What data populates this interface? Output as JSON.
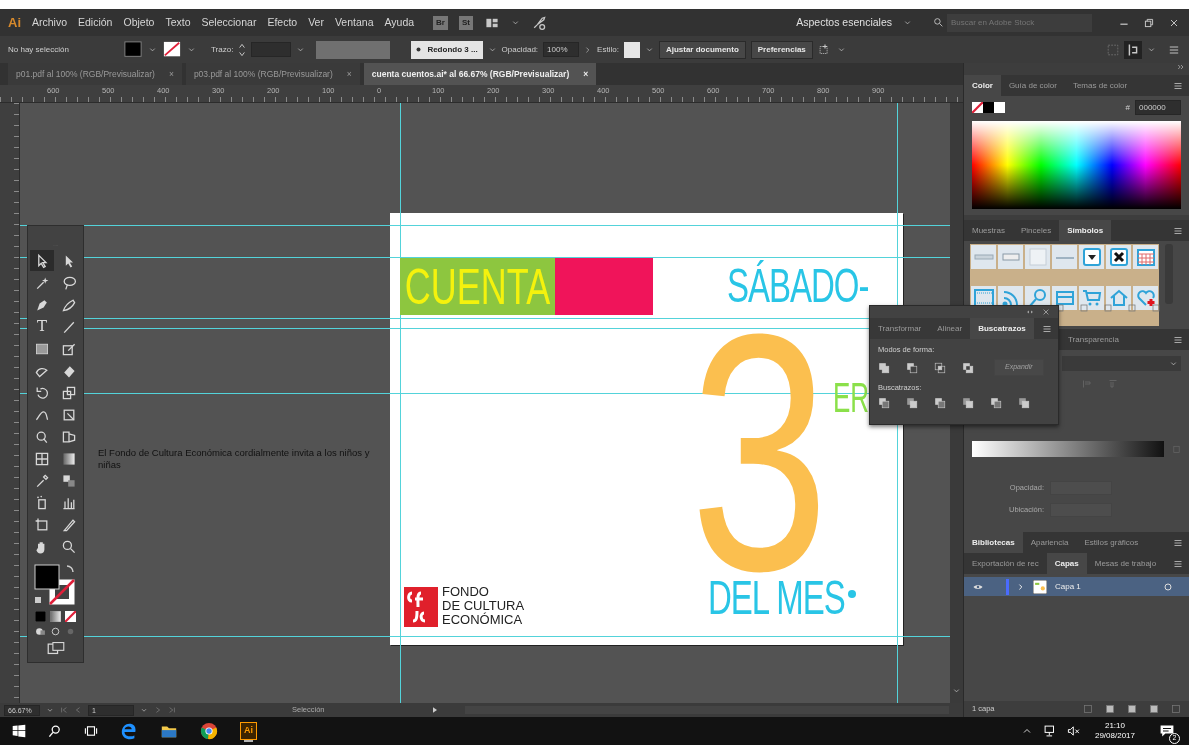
{
  "menu_bar": {
    "logo": "Ai",
    "items": [
      "Archivo",
      "Edición",
      "Objeto",
      "Texto",
      "Seleccionar",
      "Efecto",
      "Ver",
      "Ventana",
      "Ayuda"
    ],
    "bridge": "Br",
    "stock": "St",
    "workspace": "Aspectos esenciales",
    "search": {
      "placeholder": "Buscar en Adobe Stock"
    }
  },
  "control_bar": {
    "selection": "No hay selección",
    "stroke_label": "Trazo:",
    "brush": "Redondo 3 ...",
    "opacity_label": "Opacidad:",
    "opacity": "100%",
    "style_label": "Estilo:",
    "buttons": [
      "Ajustar documento",
      "Preferencias"
    ]
  },
  "document_tabs": [
    {
      "label": "p01.pdf al 100% (RGB/Previsualizar)",
      "close": "×",
      "selected": false
    },
    {
      "label": "p03.pdf al 100% (RGB/Previsualizar)",
      "close": "×",
      "selected": false
    },
    {
      "label": "cuenta cuentos.ai* al 66.67% (RGB/Previsualizar)",
      "close": "×",
      "selected": true
    }
  ],
  "ruler": {
    "labels": [
      "600",
      "500",
      "400",
      "300",
      "200",
      "100",
      "0",
      "100",
      "200",
      "300",
      "400",
      "500",
      "600",
      "700",
      "800",
      "900"
    ]
  },
  "toolbox": {
    "type_tool": "T"
  },
  "canvas": {
    "note": "El Fondo de Cultura Económica cordialmente invita a los niños y niñas",
    "artboard": {
      "title_word": "CUENTA",
      "day": "SÁBADO-",
      "number": "3",
      "suffix": "ER",
      "month": "DEL MES",
      "logo_lines": [
        "FONDO",
        "DE CULTURA",
        "ECONÓMICA"
      ]
    }
  },
  "pathfinder_panel": {
    "tabs": [
      {
        "label": "Transformar",
        "selected": false
      },
      {
        "label": "Alinear",
        "selected": false
      },
      {
        "label": "Buscatrazos",
        "selected": true
      }
    ],
    "shape_modes_label": "Modos de forma:",
    "expand_button": {
      "label": "Expandir",
      "disabled": true
    },
    "pathfinders_label": "Buscatrazos:"
  },
  "color_panel": {
    "tabs": [
      {
        "label": "Color",
        "selected": true
      },
      {
        "label": "Guía de color",
        "selected": false
      },
      {
        "label": "Temas de color",
        "selected": false
      }
    ],
    "hex_label": "#",
    "hex": "000000"
  },
  "symbols_panel": {
    "tabs": [
      {
        "label": "Muestras",
        "selected": false
      },
      {
        "label": "Pinceles",
        "selected": false
      },
      {
        "label": "Símbolos",
        "selected": true
      }
    ]
  },
  "transparency_panel": {
    "tabs": [
      {
        "label": "Transparencia",
        "selected": false
      }
    ],
    "opacity_label": "Opacidad:",
    "location_label": "Ubicación:"
  },
  "libraries_panel": {
    "tabs": [
      {
        "label": "Bibliotecas",
        "selected": true
      },
      {
        "label": "Apariencia",
        "selected": false
      },
      {
        "label": "Estilos gráficos",
        "selected": false
      }
    ]
  },
  "layers_panel": {
    "tabs": [
      {
        "label": "Exportación de rec",
        "selected": false
      },
      {
        "label": "Capas",
        "selected": true
      },
      {
        "label": "Mesas de trabajo",
        "selected": false
      }
    ],
    "layers": [
      {
        "name": "Capa 1",
        "visible": true,
        "selected": true,
        "expanded": false
      }
    ],
    "footer": "1 capa"
  },
  "status_bar": {
    "zoom": "66.67%",
    "artboard": "1",
    "tool": "Selección"
  },
  "taskbar": {
    "app_label": "Ai",
    "time": "21:10",
    "date": "29/08/2017",
    "notifications": "2"
  }
}
